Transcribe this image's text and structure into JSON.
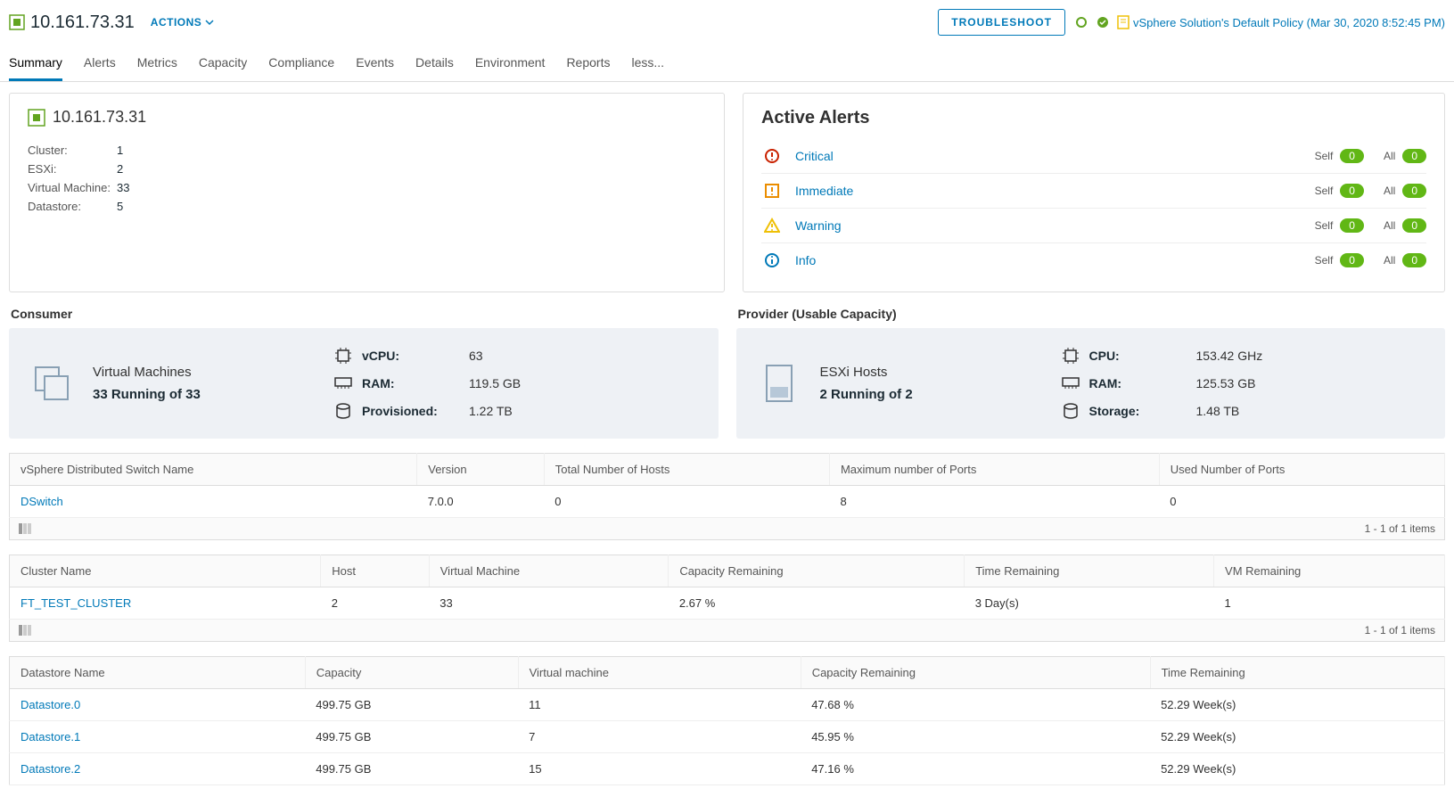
{
  "header": {
    "title": "10.161.73.31",
    "actions_label": "ACTIONS",
    "troubleshoot_label": "TROUBLESHOOT",
    "policy_text": "vSphere Solution's Default Policy (Mar 30, 2020 8:52:45 PM)"
  },
  "tabs": [
    "Summary",
    "Alerts",
    "Metrics",
    "Capacity",
    "Compliance",
    "Events",
    "Details",
    "Environment",
    "Reports",
    "less..."
  ],
  "active_tab_index": 0,
  "summary_card": {
    "title": "10.161.73.31",
    "rows": [
      {
        "k": "Cluster:",
        "v": "1"
      },
      {
        "k": "ESXi:",
        "v": "2"
      },
      {
        "k": "Virtual Machine:",
        "v": "33"
      },
      {
        "k": "Datastore:",
        "v": "5"
      }
    ]
  },
  "alerts_card": {
    "title": "Active Alerts",
    "self_label": "Self",
    "all_label": "All",
    "rows": [
      {
        "label": "Critical",
        "self": "0",
        "all": "0",
        "color": "#c92100",
        "kind": "circle"
      },
      {
        "label": "Immediate",
        "self": "0",
        "all": "0",
        "color": "#eb8d00",
        "kind": "square"
      },
      {
        "label": "Warning",
        "self": "0",
        "all": "0",
        "color": "#efc006",
        "kind": "triangle"
      },
      {
        "label": "Info",
        "self": "0",
        "all": "0",
        "color": "#0079b8",
        "kind": "info"
      }
    ]
  },
  "consumer": {
    "title": "Consumer",
    "main_title": "Virtual Machines",
    "main_sub": "33 Running of 33",
    "specs": [
      {
        "label": "vCPU:",
        "value": "63",
        "icon": "cpu"
      },
      {
        "label": "RAM:",
        "value": "119.5 GB",
        "icon": "ram"
      },
      {
        "label": "Provisioned:",
        "value": "1.22 TB",
        "icon": "disk"
      }
    ]
  },
  "provider": {
    "title": "Provider (Usable Capacity)",
    "main_title": "ESXi Hosts",
    "main_sub": "2 Running of 2",
    "specs": [
      {
        "label": "CPU:",
        "value": "153.42 GHz",
        "icon": "cpu"
      },
      {
        "label": "RAM:",
        "value": "125.53 GB",
        "icon": "ram"
      },
      {
        "label": "Storage:",
        "value": "1.48 TB",
        "icon": "disk"
      }
    ]
  },
  "switch_table": {
    "headers": [
      "vSphere Distributed Switch Name",
      "Version",
      "Total Number of Hosts",
      "Maximum number of Ports",
      "Used Number of Ports"
    ],
    "rows": [
      [
        "DSwitch",
        "7.0.0",
        "0",
        "8",
        "0"
      ]
    ],
    "footer": "1 - 1 of 1 items"
  },
  "cluster_table": {
    "headers": [
      "Cluster Name",
      "Host",
      "Virtual Machine",
      "Capacity Remaining",
      "Time Remaining",
      "VM Remaining"
    ],
    "rows": [
      [
        "FT_TEST_CLUSTER",
        "2",
        "33",
        "2.67 %",
        "3 Day(s)",
        "1"
      ]
    ],
    "footer": "1 - 1 of 1 items"
  },
  "datastore_table": {
    "headers": [
      "Datastore Name",
      "Capacity",
      "Virtual machine",
      "Capacity Remaining",
      "Time Remaining"
    ],
    "rows": [
      [
        "Datastore.0",
        "499.75 GB",
        "11",
        "47.68 %",
        "52.29 Week(s)"
      ],
      [
        "Datastore.1",
        "499.75 GB",
        "7",
        "45.95 %",
        "52.29 Week(s)"
      ],
      [
        "Datastore.2",
        "499.75 GB",
        "15",
        "47.16 %",
        "52.29 Week(s)"
      ]
    ]
  }
}
